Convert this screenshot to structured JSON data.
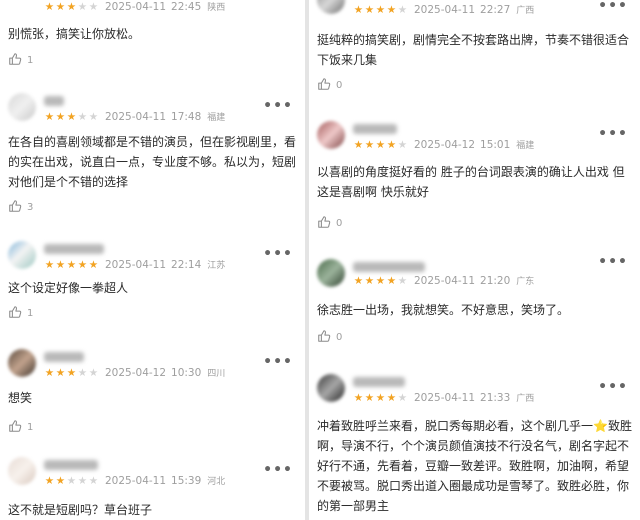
{
  "left": {
    "reviews": [
      {
        "stars": 3,
        "date": "2025-04-11",
        "time": "22:45",
        "location": "陕西",
        "text": "别慌张，搞笑让你放松。",
        "likes": "1"
      },
      {
        "stars": 3,
        "date": "2025-04-11",
        "time": "17:48",
        "location": "福建",
        "text": "在各自的喜剧领域都是不错的演员，但在影视剧里，看的实在出戏，说直白一点，专业度不够。私以为，短剧对他们是个不错的选择",
        "likes": "3"
      },
      {
        "stars": 5,
        "date": "2025-04-11",
        "time": "22:14",
        "location": "江苏",
        "text": "这个设定好像一拳超人",
        "likes": "1"
      },
      {
        "stars": 3,
        "date": "2025-04-12",
        "time": "10:30",
        "location": "四川",
        "text": "想笑",
        "likes": "1"
      },
      {
        "stars": 2,
        "date": "2025-04-11",
        "time": "15:39",
        "location": "河北",
        "text": "这不就是短剧吗？草台班子",
        "likes": ""
      }
    ]
  },
  "right": {
    "reviews": [
      {
        "stars": 4,
        "date": "2025-04-11",
        "time": "22:27",
        "location": "广西",
        "text": "挺纯粹的搞笑剧，剧情完全不按套路出牌，节奏不错很适合下饭来几集",
        "likes": "0"
      },
      {
        "stars": 4,
        "date": "2025-04-12",
        "time": "15:01",
        "location": "福建",
        "text": "以喜剧的角度挺好看的 胜子的台词跟表演的确让人出戏 但这是喜剧啊 快乐就好",
        "likes": "0"
      },
      {
        "stars": 4,
        "date": "2025-04-11",
        "time": "21:20",
        "location": "广东",
        "text": "徐志胜一出场，我就想笑。不好意思，笑场了。",
        "likes": "0"
      },
      {
        "stars": 4,
        "date": "2025-04-11",
        "time": "21:33",
        "location": "广西",
        "text_before": "冲着致胜呼兰来看，脱口秀每期必看，这个剧几乎一",
        "emoji": "⭐",
        "text_after": "致胜啊，导演不行，个个演员颜值演技不行没名气，剧名字起不好行不通，先看着，豆瓣一致差评。致胜啊，加油啊，希望不要被骂。脱口秀出道入圈最成功是雪琴了。致胜必胜，你的第一部男主",
        "likes": ""
      }
    ]
  },
  "more_label": "•••",
  "colors": {
    "star_on": "#f2a322",
    "star_off": "#d4d4d4",
    "meta": "#9e9e9e",
    "text": "#2a2a2a"
  }
}
